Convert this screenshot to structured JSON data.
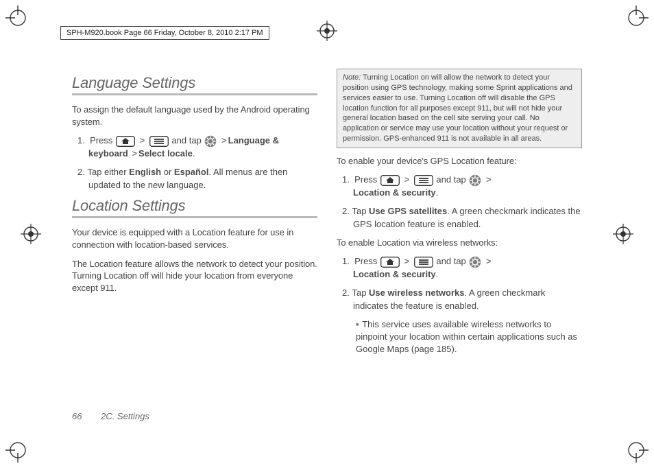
{
  "meta": {
    "header_text": "SPH-M920.book  Page 66  Friday, October 8, 2010  2:17 PM"
  },
  "left": {
    "h1a": "Language Settings",
    "p1": "To assign the default language used by the Android operating system.",
    "s1_press": "Press",
    "s1_andtap": "and tap",
    "s1_path1": "Language & keyboard",
    "s1_path2": "Select locale",
    "s2_a": "Tap either ",
    "s2_eng": "English",
    "s2_or": " or ",
    "s2_esp": "Español",
    "s2_b": ". All menus are then updated to the new language.",
    "h1b": "Location Settings",
    "p2": "Your device is equipped with a Location feature for use in connection with location-based services.",
    "p3": "The Location feature allows the network to detect your position. Turning Location off will hide your location from everyone except 911."
  },
  "right": {
    "note_label": "Note:",
    "note_body": "Turning Location on will allow the network to detect your position using GPS technology, making some Sprint applications and services easier to use. Turning Location off will disable the GPS location function for all purposes except 911, but will not hide your general location based on the cell site serving your call. No application or service may use your location without your request or permission. GPS-enhanced 911 is not available in all areas.",
    "p_gps": "To enable your device's GPS Location feature:",
    "g1_press": "Press",
    "g1_andtap": "and tap",
    "g1_path": "Location & security",
    "g2_a": "Tap ",
    "g2_bold": "Use GPS satellites",
    "g2_b": ". A green checkmark indicates the GPS location feature is enabled.",
    "p_wifi": "To enable Location via wireless networks:",
    "w1_press": "Press",
    "w1_andtap": "and tap",
    "w1_path": "Location & security",
    "w2_a": "Tap ",
    "w2_bold": "Use wireless networks",
    "w2_b": ". A green checkmark indicates the feature is enabled.",
    "sub": "This service uses available wireless networks to pinpoint your location within certain applications such as Google Maps (page 185)."
  },
  "footer": {
    "page_no": "66",
    "section": "2C. Settings"
  },
  "glyphs": {
    "gt": ">"
  }
}
